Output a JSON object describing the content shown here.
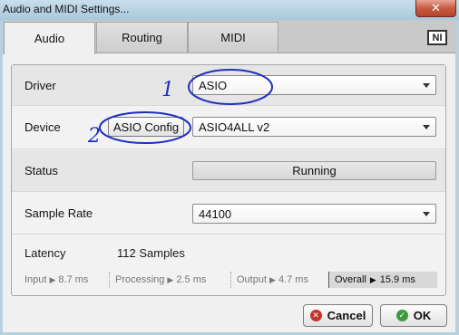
{
  "window": {
    "title": "Audio and MIDI Settings...",
    "close_glyph": "✕"
  },
  "tabs": [
    {
      "label": "Audio",
      "active": true
    },
    {
      "label": "Routing",
      "active": false
    },
    {
      "label": "MIDI",
      "active": false
    }
  ],
  "logo": {
    "text": "NI"
  },
  "driver": {
    "label": "Driver",
    "value": "ASIO"
  },
  "device": {
    "label": "Device",
    "config_button": "ASIO Config",
    "value": "ASIO4ALL v2"
  },
  "status": {
    "label": "Status",
    "value": "Running"
  },
  "sample_rate": {
    "label": "Sample Rate",
    "value": "44100"
  },
  "latency": {
    "label": "Latency",
    "value": "112 Samples",
    "input_label": "Input",
    "input_value": "8.7 ms",
    "processing_label": "Processing",
    "processing_value": "2.5 ms",
    "output_label": "Output",
    "output_value": "4.7 ms",
    "overall_label": "Overall",
    "overall_value": "15.9 ms",
    "arrow": "▶"
  },
  "buttons": {
    "cancel": "Cancel",
    "ok": "OK",
    "cancel_glyph": "✕",
    "ok_glyph": "✓"
  },
  "annotations": {
    "mark_1": "1",
    "mark_2": "2",
    "ink_color": "#1f2fbf"
  },
  "colors": {
    "close_red": "#c75c43",
    "title_blue": "#a9c8db"
  }
}
